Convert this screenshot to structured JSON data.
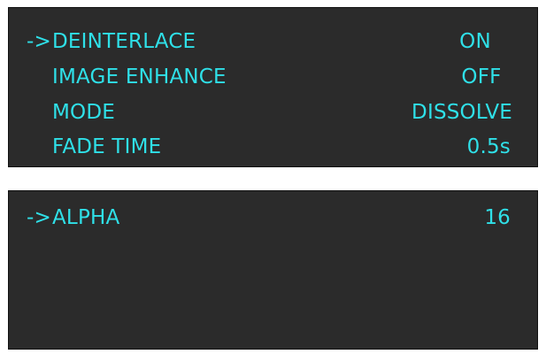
{
  "colors": {
    "panel_bg": "#2b2b2b",
    "text": "#2fe0e8"
  },
  "menu_top": {
    "cursor": "->",
    "items": [
      {
        "label": "DEINTERLACE",
        "value": "ON",
        "selected": true
      },
      {
        "label": "IMAGE ENHANCE",
        "value": "OFF",
        "selected": false
      },
      {
        "label": "MODE",
        "value": "DISSOLVE",
        "selected": false
      },
      {
        "label": "FADE TIME",
        "value": "0.5s",
        "selected": false
      }
    ]
  },
  "menu_bottom": {
    "cursor": "->",
    "items": [
      {
        "label": "ALPHA",
        "value": "16",
        "selected": true
      }
    ]
  }
}
